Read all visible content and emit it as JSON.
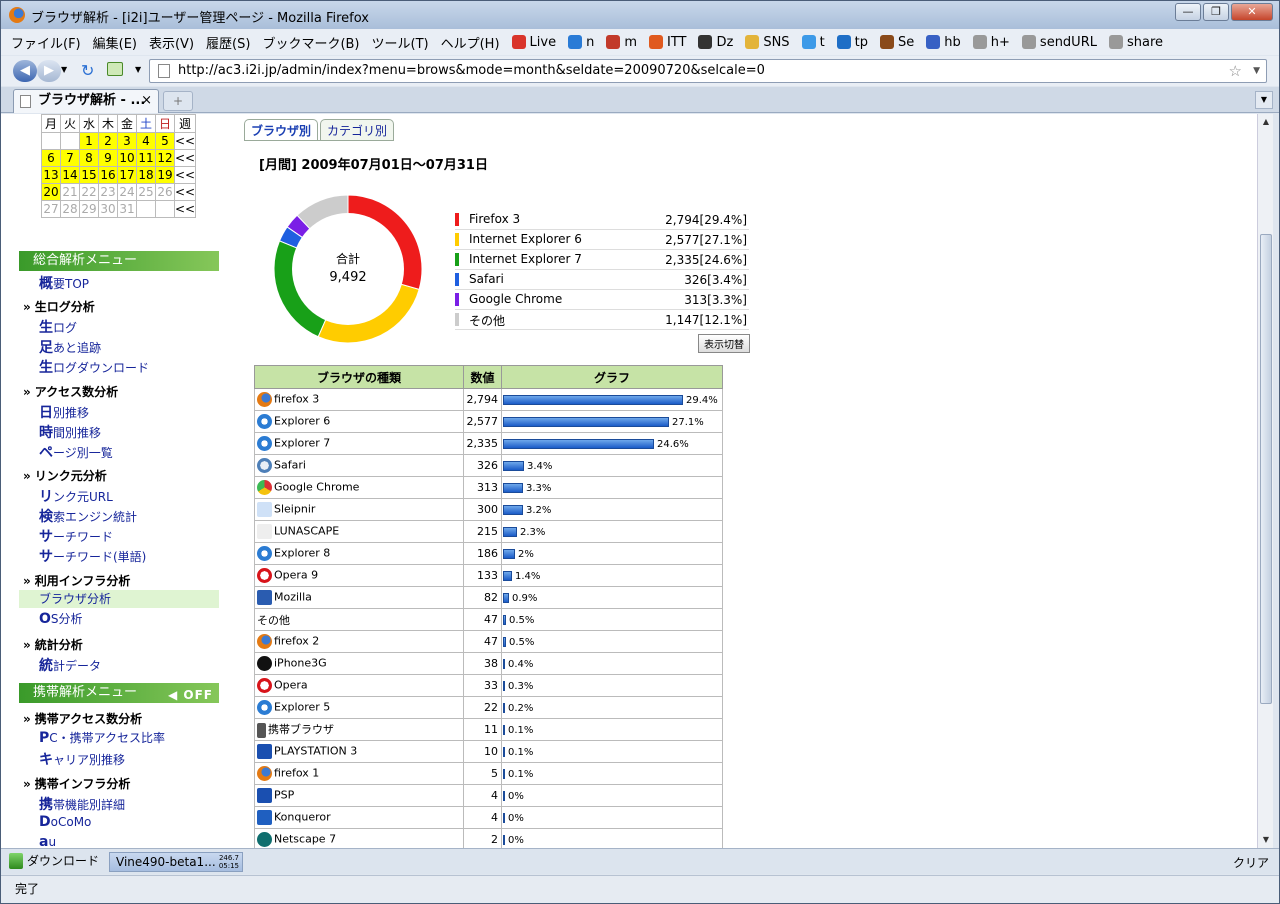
{
  "window": {
    "title": "ブラウザ解析 - [i2i]ユーザー管理ページ - Mozilla Firefox"
  },
  "menu": {
    "items": [
      "ファイル(F)",
      "編集(E)",
      "表示(V)",
      "履歴(S)",
      "ブックマーク(B)",
      "ツール(T)",
      "ヘルプ(H)"
    ],
    "bookmarks": [
      "Live",
      "n",
      "m",
      "ITT",
      "Dz",
      "SNS",
      "t",
      "tp",
      "Se",
      "hb",
      "h+",
      "sendURL",
      "share"
    ]
  },
  "nav": {
    "url": "http://ac3.i2i.jp/admin/index?menu=brows&mode=month&seldate=20090720&selcale=0"
  },
  "tab": {
    "label": "ブラウザ解析 - ...",
    "close": "×",
    "new": "+"
  },
  "calendar": {
    "headers": [
      "月",
      "火",
      "水",
      "木",
      "金",
      "土",
      "日",
      "週"
    ],
    "rows": [
      [
        "",
        "",
        "1",
        "2",
        "3",
        "4",
        "5",
        "<<"
      ],
      [
        "6",
        "7",
        "8",
        "9",
        "10",
        "11",
        "12",
        "<<"
      ],
      [
        "13",
        "14",
        "15",
        "16",
        "17",
        "18",
        "19",
        "<<"
      ],
      [
        "20",
        "21",
        "22",
        "23",
        "24",
        "25",
        "26",
        "<<"
      ],
      [
        "27",
        "28",
        "29",
        "30",
        "31",
        "",
        "",
        "<<"
      ]
    ]
  },
  "side": {
    "head1": "総合解析メニュー",
    "head2": "携帯解析メニュー",
    "off": "OFF",
    "summary": {
      "first": "概",
      "rest": "要TOP"
    },
    "sections": {
      "rawlog": "生ログ分析",
      "access": "アクセス数分析",
      "link": "リンク元分析",
      "infra": "利用インフラ分析",
      "stats": "統計分析",
      "mobile_access": "携帯アクセス数分析",
      "mobile_infra": "携帯インフラ分析"
    },
    "items": {
      "raw_log": {
        "first": "生",
        "rest": "ログ"
      },
      "footprint": {
        "first": "足",
        "rest": "あと追跡"
      },
      "raw_download": {
        "first": "生",
        "rest": "ログダウンロード"
      },
      "daily": {
        "first": "日",
        "rest": "別推移"
      },
      "hourly": {
        "first": "時",
        "rest": "間別推移"
      },
      "pages": {
        "first": "ペ",
        "rest": "ージ別一覧"
      },
      "ref_url": {
        "first": "リ",
        "rest": "ンク元URL"
      },
      "search_engine": {
        "first": "検",
        "rest": "索エンジン統計"
      },
      "search_word": {
        "first": "サ",
        "rest": "ーチワード"
      },
      "search_word_single": {
        "first": "サ",
        "rest": "ーチワード(単語)"
      },
      "browser": "ブラウザ分析",
      "os": {
        "first": "O",
        "rest": "S分析"
      },
      "stat_data": {
        "first": "統",
        "rest": "計データ"
      },
      "pc_mobile": {
        "first": "P",
        "rest": "C・携帯アクセス比率"
      },
      "carrier": {
        "first": "キ",
        "rest": "ャリア別推移"
      },
      "mobile_func": {
        "first": "携",
        "rest": "帯機能別詳細"
      },
      "docomo": {
        "first": "D",
        "rest": "oCoMo"
      },
      "au": {
        "first": "a",
        "rest": "u"
      }
    }
  },
  "main": {
    "tabs": [
      "ブラウザ別",
      "カテゴリ別"
    ],
    "period": "[月間] 2009年07月01日～07月31日",
    "total_label": "合計",
    "total_value": "9,492",
    "switch_button": "表示切替",
    "table_headers": [
      "ブラウザの種類",
      "数値",
      "グラフ"
    ]
  },
  "colors": {
    "firefox": "#ee1c1c",
    "ie6": "#ffcc00",
    "ie7": "#18a018",
    "safari": "#1f5fe0",
    "chrome": "#7a1fe6",
    "other": "#cccccc"
  },
  "chart_data": {
    "type": "pie",
    "categories": [
      "Firefox 3",
      "Internet Explorer 6",
      "Internet Explorer 7",
      "Safari",
      "Google Chrome",
      "その他"
    ],
    "values": [
      2794,
      2577,
      2335,
      326,
      313,
      1147
    ],
    "labels": [
      "2,794[29.4%]",
      "2,577[27.1%]",
      "2,335[24.6%]",
      "326[3.4%]",
      "313[3.3%]",
      "1,147[12.1%]"
    ],
    "colors": [
      "#ee1c1c",
      "#ffcc00",
      "#18a018",
      "#1f5fe0",
      "#7a1fe6",
      "#cccccc"
    ]
  },
  "table_rows": [
    {
      "name": "firefox 3",
      "value": "2,794",
      "pct": 29.4,
      "label": "29.4%",
      "icon": "firefox-icon"
    },
    {
      "name": "Explorer 6",
      "value": "2,577",
      "pct": 27.1,
      "label": "27.1%",
      "icon": "ie-icon"
    },
    {
      "name": "Explorer 7",
      "value": "2,335",
      "pct": 24.6,
      "label": "24.6%",
      "icon": "ie-icon"
    },
    {
      "name": "Safari",
      "value": "326",
      "pct": 3.4,
      "label": "3.4%",
      "icon": "safari-icon"
    },
    {
      "name": "Google Chrome",
      "value": "313",
      "pct": 3.3,
      "label": "3.3%",
      "icon": "chrome-icon"
    },
    {
      "name": "Sleipnir",
      "value": "300",
      "pct": 3.2,
      "label": "3.2%",
      "icon": "sleipnir-icon"
    },
    {
      "name": "LUNASCAPE",
      "value": "215",
      "pct": 2.3,
      "label": "2.3%",
      "icon": "lunascape-icon"
    },
    {
      "name": "Explorer 8",
      "value": "186",
      "pct": 2,
      "label": "2%",
      "icon": "ie-icon"
    },
    {
      "name": "Opera 9",
      "value": "133",
      "pct": 1.4,
      "label": "1.4%",
      "icon": "opera-icon"
    },
    {
      "name": "Mozilla",
      "value": "82",
      "pct": 0.9,
      "label": "0.9%",
      "icon": "mozilla-icon"
    },
    {
      "name": "その他",
      "value": "47",
      "pct": 0.5,
      "label": "0.5%",
      "icon": ""
    },
    {
      "name": "firefox 2",
      "value": "47",
      "pct": 0.5,
      "label": "0.5%",
      "icon": "firefox-icon"
    },
    {
      "name": "iPhone3G",
      "value": "38",
      "pct": 0.4,
      "label": "0.4%",
      "icon": "apple-icon"
    },
    {
      "name": "Opera",
      "value": "33",
      "pct": 0.3,
      "label": "0.3%",
      "icon": "opera-icon"
    },
    {
      "name": "Explorer 5",
      "value": "22",
      "pct": 0.2,
      "label": "0.2%",
      "icon": "ie-icon"
    },
    {
      "name": "携帯ブラウザ",
      "value": "11",
      "pct": 0.1,
      "label": "0.1%",
      "icon": "mobile-phone-icon"
    },
    {
      "name": "PLAYSTATION 3",
      "value": "10",
      "pct": 0.1,
      "label": "0.1%",
      "icon": "playstation-icon"
    },
    {
      "name": "firefox 1",
      "value": "5",
      "pct": 0.1,
      "label": "0.1%",
      "icon": "firefox-icon"
    },
    {
      "name": "PSP",
      "value": "4",
      "pct": 0,
      "label": "0%",
      "icon": "playstation-icon"
    },
    {
      "name": "Konqueror",
      "value": "4",
      "pct": 0,
      "label": "0%",
      "icon": "konqueror-icon"
    },
    {
      "name": "Netscape 7",
      "value": "2",
      "pct": 0,
      "label": "0%",
      "icon": "netscape-icon"
    }
  ],
  "downloads": {
    "button": "ダウンロード",
    "item": "Vine490-beta1...",
    "size": "246.7",
    "time": "05:15",
    "clear": "クリア"
  },
  "status": {
    "text": "完了"
  }
}
